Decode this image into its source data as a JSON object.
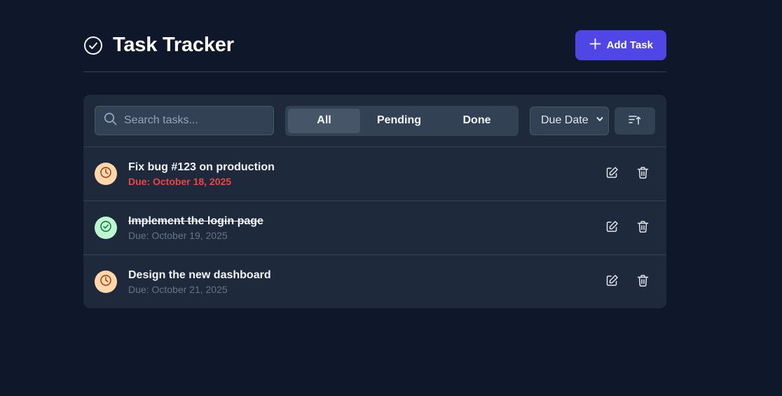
{
  "header": {
    "title": "Task Tracker",
    "add_label": "Add Task",
    "logo_icon": "check-circle-icon"
  },
  "toolbar": {
    "search_placeholder": "Search tasks...",
    "filters": [
      {
        "label": "All",
        "active": true
      },
      {
        "label": "Pending",
        "active": false
      },
      {
        "label": "Done",
        "active": false
      }
    ],
    "sort_value": "Due Date",
    "sort_dir_icon": "sort-ascending-icon"
  },
  "tasks": [
    {
      "name": "Fix bug #123 on production",
      "due": "Due: October 18, 2025",
      "status": "pending",
      "overdue": true
    },
    {
      "name": "Implement the login page",
      "due": "Due: October 19, 2025",
      "status": "done",
      "overdue": false
    },
    {
      "name": "Design the new dashboard",
      "due": "Due: October 21, 2025",
      "status": "pending",
      "overdue": false
    }
  ],
  "colors": {
    "background": "#0f172a",
    "card": "#1e293b",
    "accent": "#4f46e5",
    "overdue": "#ef4444",
    "pending_badge": "#fed7aa",
    "done_badge": "#bbf7d0"
  }
}
